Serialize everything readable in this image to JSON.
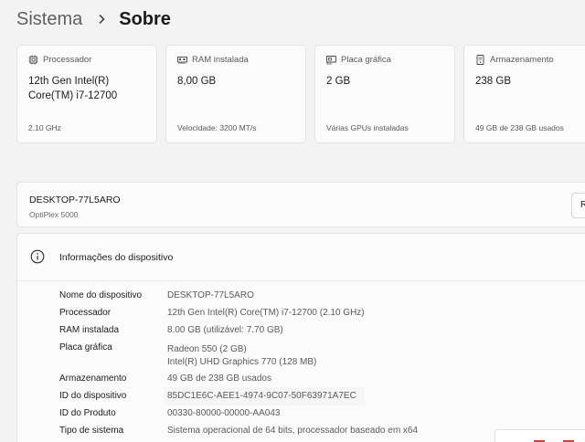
{
  "breadcrumb": {
    "parent": "Sistema",
    "current": "Sobre"
  },
  "specs": [
    {
      "label": "Processador",
      "value": "12th Gen Intel(R) Core(TM) i7-12700",
      "sub": "2.10 GHz",
      "icon": "processor-icon"
    },
    {
      "label": "RAM instalada",
      "value": "8,00 GB",
      "sub": "Velocidade: 3200 MT/s",
      "icon": "ram-icon"
    },
    {
      "label": "Placa gráfica",
      "value": "2 GB",
      "sub": "Várias GPUs instaladas",
      "icon": "graphics-card-icon"
    },
    {
      "label": "Armazenamento",
      "value": "238 GB",
      "sub": "49 GB de 238 GB usados",
      "icon": "storage-icon"
    }
  ],
  "device": {
    "name": "DESKTOP-77L5ARO",
    "model": "OptiPlex 5000",
    "rename_label": "Renomear este PC"
  },
  "info": {
    "title": "Informações do dispositivo",
    "rows": [
      {
        "key": "Nome do dispositivo",
        "value": "DESKTOP-77L5ARO"
      },
      {
        "key": "Processador",
        "value": "12th Gen Intel(R) Core(TM) i7-12700 (2.10 GHz)"
      },
      {
        "key": "RAM instalada",
        "value": "8.00 GB (utilizável: 7.70 GB)"
      },
      {
        "key": "Placa gráfica",
        "value": "Radeon 550 (2 GB)",
        "value2": "Intel(R) UHD Graphics 770 (128 MB)"
      },
      {
        "key": "Armazenamento",
        "value": "49 GB de 238 GB usados"
      },
      {
        "key": "ID do dispositivo",
        "value": "85DC1E6C-AEE1-4974-9C07-50F63971A7EC"
      },
      {
        "key": "ID do Produto",
        "value": "00330-80000-00000-AA043"
      },
      {
        "key": "Tipo de sistema",
        "value": "Sistema operacional de 64 bits, processador baseado em x64"
      }
    ]
  },
  "colors": {
    "background": "#f3f3f3",
    "card": "#fbfbfb",
    "border": "#e5e5e5",
    "muted_text": "#5a5a5a"
  }
}
